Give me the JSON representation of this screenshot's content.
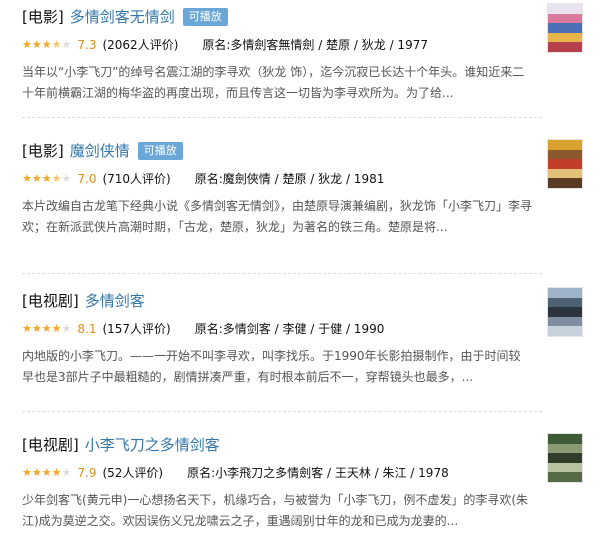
{
  "results": [
    {
      "category": "[电影]",
      "title": "多情剑客无情剑",
      "badge": "可播放",
      "stars": [
        1,
        1,
        1,
        0.5,
        0
      ],
      "rating": "7.3",
      "count": "(2062人评价)",
      "subject": "原名:多情劍客無情劍 / 楚原 / 狄龙 / 1977",
      "desc": "当年以“小李飞刀”的绰号名震江湖的李寻欢（狄龙 饰），迄今沉寂已长达十个年头。谁知近来二十年前横霸江湖的梅华盗的再度出现，而且传言这一切皆为李寻欢所为。为了给...",
      "poster_colors": [
        "#e9e4ef",
        "#d77a9b",
        "#4a6fb4",
        "#e8b44c",
        "#b7414a"
      ]
    },
    {
      "category": "[电影]",
      "title": "魔剑侠情",
      "badge": "可播放",
      "stars": [
        1,
        1,
        1,
        0.5,
        0
      ],
      "rating": "7.0",
      "count": "(710人评价)",
      "subject": "原名:魔劍俠情 / 楚原 / 狄龙 / 1981",
      "desc": "本片改编自古龙笔下经典小说《多情剑客无情剑》，由楚原导演兼编剧，狄龙饰「小李飞刀」李寻欢；在新派武侠片高潮时期，「古龙，楚原，狄龙」为著名的铁三角。楚原是将...",
      "poster_colors": [
        "#d9a12e",
        "#8a5a2e",
        "#c23d2a",
        "#e2c07a",
        "#5b3a24"
      ]
    },
    {
      "category": "[电视剧]",
      "title": "多情剑客",
      "badge": "",
      "stars": [
        1,
        1,
        1,
        1,
        0
      ],
      "rating": "8.1",
      "count": "(157人评价)",
      "subject": "原名:多情剑客 / 李健 / 于健 / 1990",
      "desc": "内地版的小李飞刀。——一开始不叫李寻欢，叫李找乐。于1990年长影拍摄制作，由于时间较早也是3部片子中最粗糙的，剧情拼凑严重，有时根本前后不一，穿帮镜头也最多，...",
      "poster_colors": [
        "#9fb3c9",
        "#4e6173",
        "#2c3440",
        "#7f8ea0",
        "#c8d2dd"
      ]
    },
    {
      "category": "[电视剧]",
      "title": "小李飞刀之多情剑客",
      "badge": "",
      "stars": [
        1,
        1,
        1,
        1,
        0
      ],
      "rating": "7.9",
      "count": "(52人评价)",
      "subject": "原名:小李飛刀之多情劍客 / 王天林 / 朱江 / 1978",
      "desc": "少年剑客飞(黄元申)一心想扬名天下，机缘巧合，与被誉为「小李飞刀，例不虚发」的李寻欢(朱江)成为莫逆之交。欢因误伤义兄龙啸云之子，重遇阔别廿年的龙和已成为龙妻的...",
      "poster_colors": [
        "#3f5a36",
        "#8a9a74",
        "#2f3d2a",
        "#b7c2a0",
        "#556b45"
      ]
    }
  ]
}
